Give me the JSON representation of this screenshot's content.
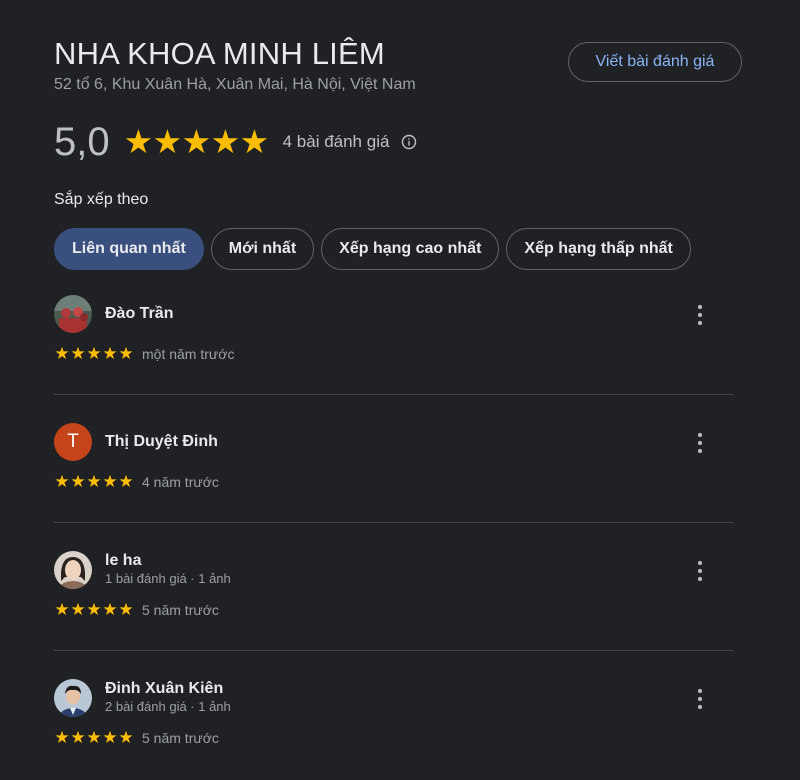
{
  "place": {
    "name": "NHA KHOA MINH LIÊM",
    "address": "52 tổ 6, Khu Xuân Hà, Xuân Mai, Hà Nội, Việt Nam",
    "rating": "5,0",
    "review_count_label": "4 bài đánh giá",
    "write_review_label": "Viết bài đánh giá"
  },
  "sort": {
    "label": "Sắp xếp theo",
    "options": [
      "Liên quan nhất",
      "Mới nhất",
      "Xếp hạng cao nhất",
      "Xếp hạng thấp nhất"
    ],
    "selected": "Liên quan nhất"
  },
  "reviews": [
    {
      "name": "Đào Trần",
      "meta": "",
      "stars": 5,
      "date": "một năm trước",
      "avatar": "photo"
    },
    {
      "name": "Thị Duyệt Đinh",
      "meta": "",
      "stars": 5,
      "date": "4 năm trước",
      "avatar_letter": "T"
    },
    {
      "name": "le ha",
      "meta": "1 bài đánh giá · 1 ảnh",
      "stars": 5,
      "date": "5 năm trước",
      "avatar": "photo"
    },
    {
      "name": "Đinh Xuân Kiên",
      "meta": "2 bài đánh giá · 1 ảnh",
      "stars": 5,
      "date": "5 năm trước",
      "avatar": "photo"
    }
  ],
  "colors": {
    "background": "#202124",
    "star": "#fbbc04",
    "accent_link": "#8ab4f8",
    "active_chip": "#394f7e",
    "letter_avatar": "#c6441a"
  },
  "icons": [
    "star-icon",
    "info-icon",
    "more-vert-icon"
  ]
}
